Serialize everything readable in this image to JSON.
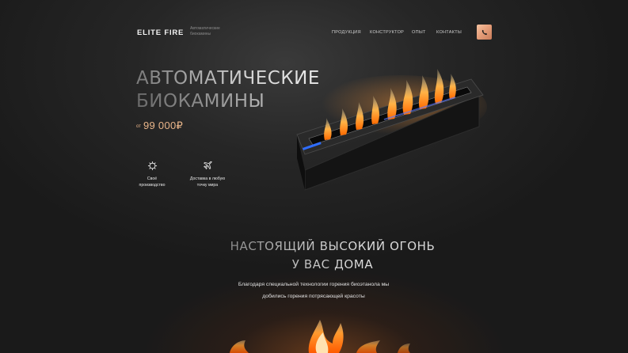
{
  "header": {
    "logo": "ELITE FIRE",
    "tagline": "Автоматические биокамины",
    "nav": [
      "ПРОДУКЦИЯ",
      "КОНСТРУКТОР",
      "ОПЫТ",
      "КОНТАКТЫ"
    ],
    "phone_icon": "phone-icon"
  },
  "hero": {
    "title_line1": "АВТОМАТИЧЕСКИЕ",
    "title_line2": "БИОКАМИНЫ",
    "price_prefix": "от",
    "price_value": "99 000₽"
  },
  "features": [
    {
      "icon": "gear-icon",
      "label_line1": "Своё",
      "label_line2": "производство"
    },
    {
      "icon": "airplane-icon",
      "label_line1": "Доставка в любую",
      "label_line2": "точку мира"
    }
  ],
  "section": {
    "title_line1": "НАСТОЯЩИЙ ВЫСОКИЙ ОГОНЬ",
    "title_line2": "У ВАС ДОМА",
    "desc_line1": "Благодаря специальной технологии горения биоэтанола мы",
    "desc_line2": "добились горения потрясающей красоты"
  },
  "colors": {
    "accent": "#e9b589",
    "phone_button": "#e7a07b",
    "background": "#222222"
  }
}
